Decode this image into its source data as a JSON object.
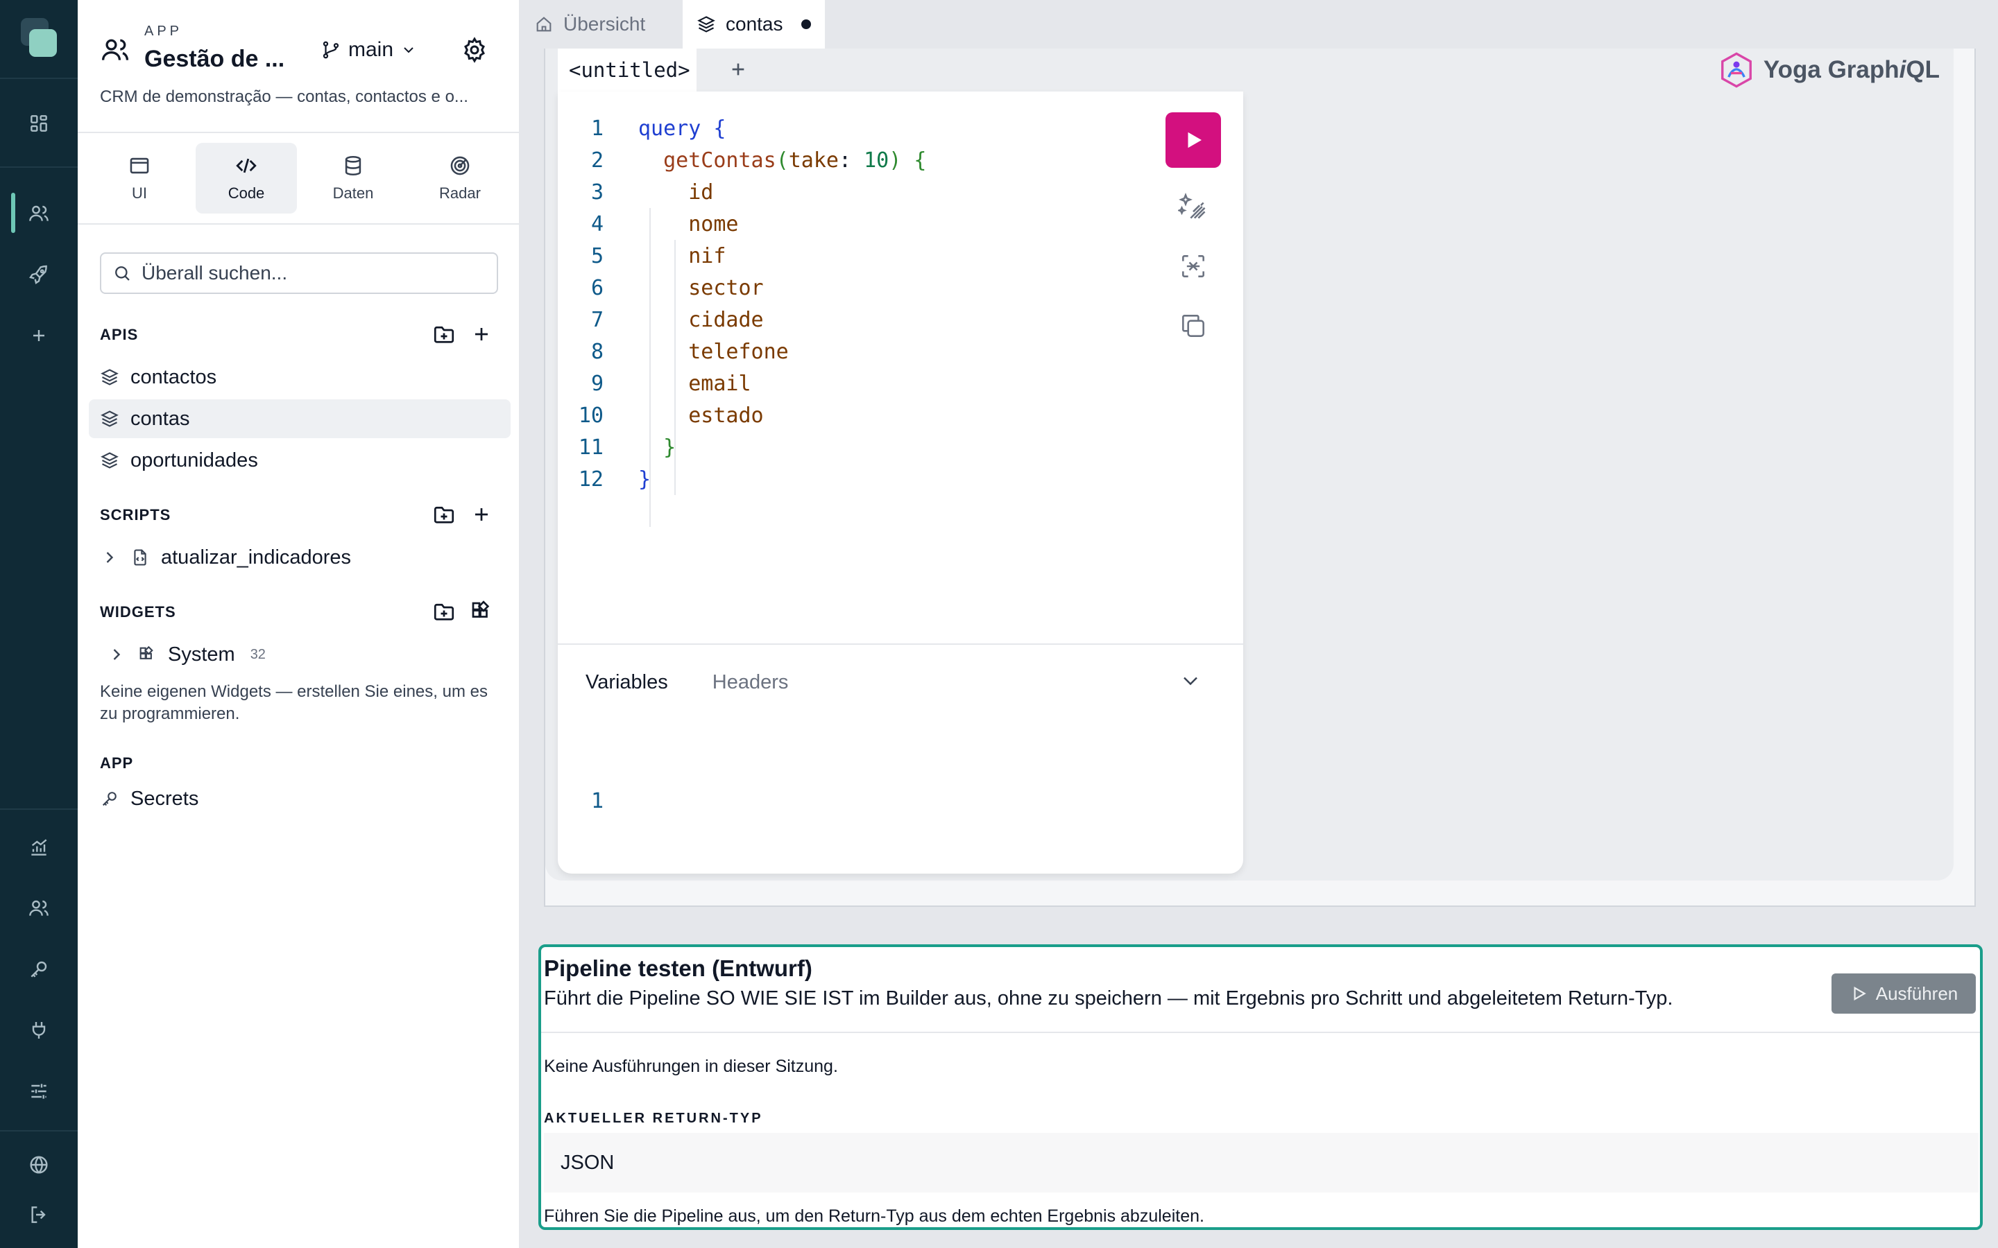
{
  "sidebar": {
    "app_kicker": "APP",
    "app_title": "Gestão de ...",
    "branch": "main",
    "description": "CRM de demonstração — contas, contactos e o...",
    "mode_tabs": [
      {
        "label": "UI",
        "icon": "window-icon"
      },
      {
        "label": "Code",
        "icon": "code-icon"
      },
      {
        "label": "Daten",
        "icon": "database-icon"
      },
      {
        "label": "Radar",
        "icon": "radar-icon"
      }
    ],
    "active_mode": "Code",
    "search_placeholder": "Überall suchen...",
    "sections": {
      "apis": {
        "title": "APIS",
        "items": [
          "contactos",
          "contas",
          "oportunidades"
        ],
        "selected": "contas"
      },
      "scripts": {
        "title": "SCRIPTS",
        "items": [
          "atualizar_indicadores"
        ]
      },
      "widgets": {
        "title": "WIDGETS",
        "system_label": "System",
        "system_count": "32",
        "note": "Keine eigenen Widgets — erstellen Sie eines, um es zu programmieren."
      },
      "app": {
        "title": "APP",
        "items": [
          "Secrets"
        ]
      }
    }
  },
  "editor_tabs": [
    {
      "label": "Übersicht",
      "icon": "home-icon",
      "active": false
    },
    {
      "label": "contas",
      "icon": "layers-icon",
      "active": true,
      "dirty": true
    }
  ],
  "graphiql": {
    "query_tab": "<untitled>",
    "brand": {
      "prefix": "Yoga Graph",
      "italic": "i",
      "suffix": "QL"
    },
    "line_numbers": [
      "1",
      "2",
      "3",
      "4",
      "5",
      "6",
      "7",
      "8",
      "9",
      "10",
      "11",
      "12"
    ],
    "query_name": "query",
    "operation": "getContas",
    "arg_name": "take",
    "arg_value": "10",
    "fields": [
      "id",
      "nome",
      "nif",
      "sector",
      "cidade",
      "telefone",
      "email",
      "estado"
    ],
    "variables_tab": "Variables",
    "headers_tab": "Headers",
    "variables_line": "1"
  },
  "pipeline": {
    "title": "Pipeline testen (Entwurf)",
    "description": "Führt die Pipeline SO WIE SIE IST im Builder aus, ohne zu speichern — mit Ergebnis pro Schritt und abgeleitetem Return-Typ.",
    "run_label": "Ausführen",
    "empty_text": "Keine Ausführungen in dieser Sitzung.",
    "return_type_label": "AKTUELLER RETURN-TYP",
    "return_type": "JSON",
    "hint": "Führen Sie die Pipeline aus, um den Return-Typ aus dem echten Ergebnis abzuleiten."
  },
  "colors": {
    "rail_bg": "#102a36",
    "accent_teal": "#1a9e8a",
    "run_button": "#d3107f"
  }
}
